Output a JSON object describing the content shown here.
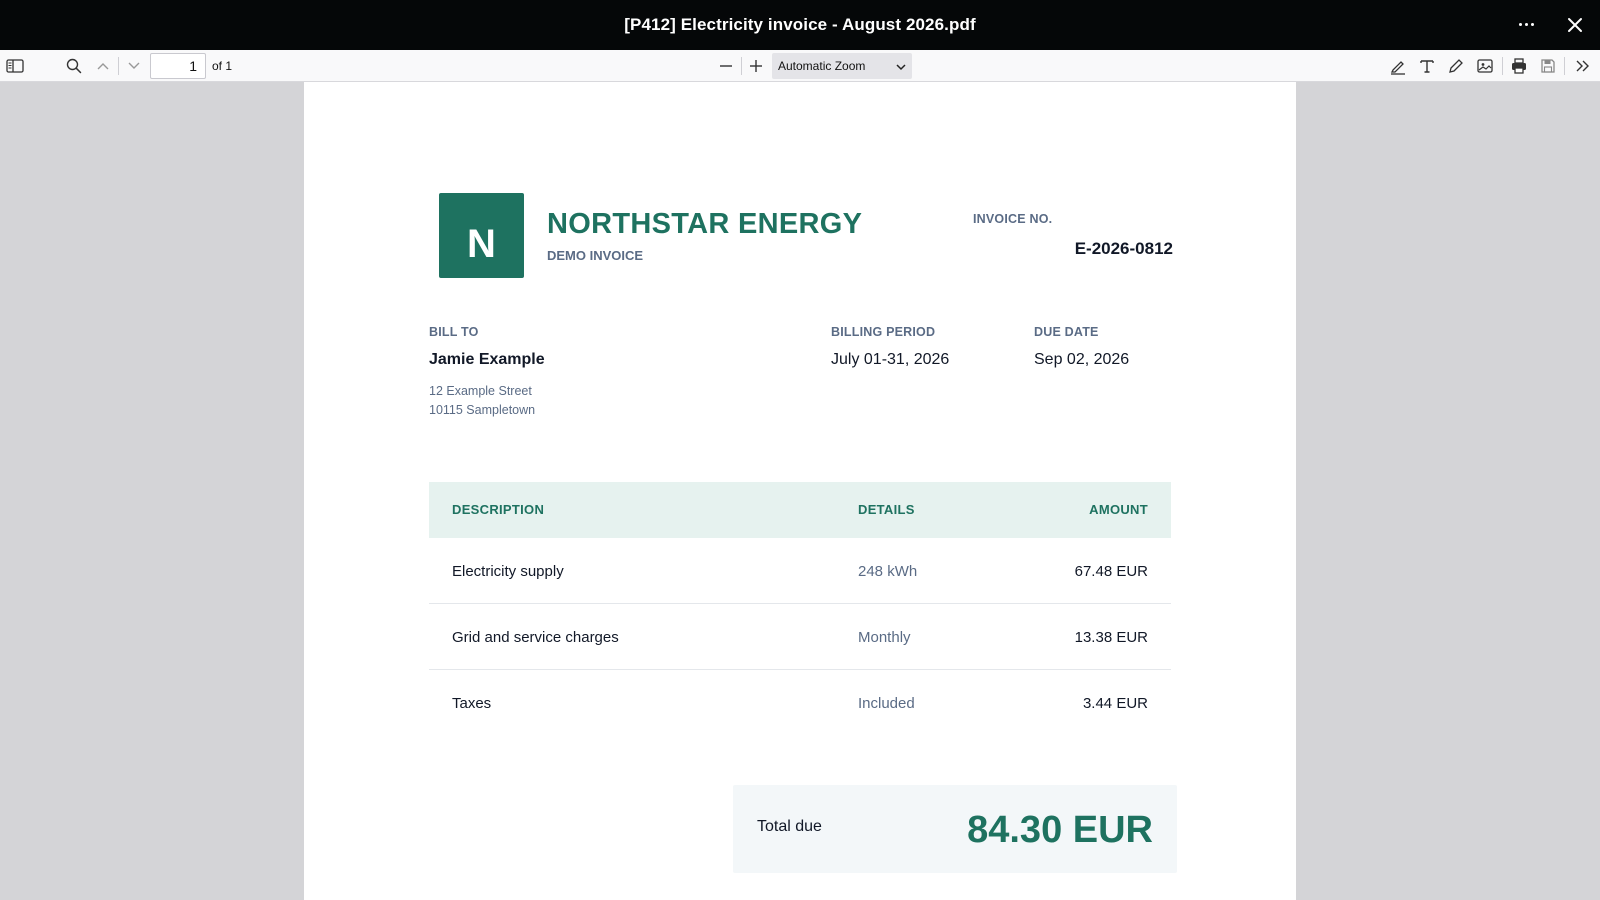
{
  "window": {
    "title": "[P412] Electricity invoice - August 2026.pdf"
  },
  "toolbar": {
    "page_number": "1",
    "page_count": "of 1",
    "zoom": "Automatic Zoom"
  },
  "invoice": {
    "logo_letter": "N",
    "company": "NORTHSTAR ENERGY",
    "subtitle": "DEMO INVOICE",
    "invoice_no_label": "INVOICE NO.",
    "invoice_no": "E-2026-0812",
    "bill_to_label": "BILL TO",
    "customer_name": "Jamie Example",
    "address_line1": "12 Example Street",
    "address_line2": "10115 Sampletown",
    "billing_period_label": "BILLING PERIOD",
    "billing_period": "July 01-31, 2026",
    "due_date_label": "DUE DATE",
    "due_date": "Sep 02, 2026",
    "table": {
      "headers": {
        "description": "DESCRIPTION",
        "details": "DETAILS",
        "amount": "AMOUNT"
      },
      "rows": [
        {
          "description": "Electricity supply",
          "details": "248 kWh",
          "amount": "67.48 EUR"
        },
        {
          "description": "Grid and service charges",
          "details": "Monthly",
          "amount": "13.38 EUR"
        },
        {
          "description": "Taxes",
          "details": "Included",
          "amount": "3.44 EUR"
        }
      ]
    },
    "total_label": "Total due",
    "total_value": "84.30 EUR"
  },
  "colors": {
    "brand": "#1e7260",
    "muted": "#5a6b85",
    "titlebar": "#050708",
    "table_header_bg": "#e6f2ef"
  },
  "icons": [
    "more-icon",
    "close-icon",
    "sidebar-toggle-icon",
    "search-icon",
    "chevron-up-icon",
    "chevron-down-icon",
    "zoom-out-icon",
    "zoom-in-icon",
    "highlight-icon",
    "text-icon",
    "draw-icon",
    "image-icon",
    "print-icon",
    "save-icon",
    "double-chevron-right-icon"
  ]
}
